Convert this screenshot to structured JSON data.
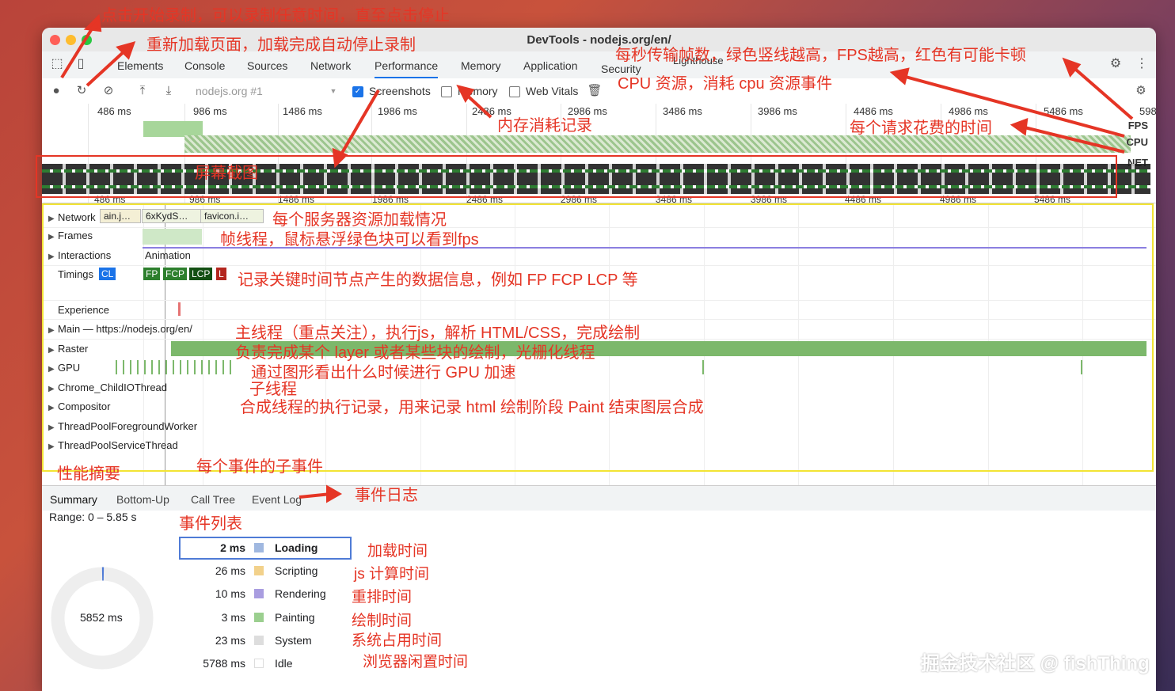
{
  "window": {
    "title": "DevTools - nodejs.org/en/"
  },
  "tabs": [
    "Elements",
    "Console",
    "Sources",
    "Network",
    "Performance",
    "Memory",
    "Application",
    "Security",
    "Lighthouse"
  ],
  "toolbar": {
    "target": "nodejs.org #1",
    "screenshots_label": "Screenshots",
    "memory_label": "Memory",
    "webvitals_label": "Web Vitals"
  },
  "overview": {
    "ticks": [
      "486 ms",
      "986 ms",
      "1486 ms",
      "1986 ms",
      "2486 ms",
      "2986 ms",
      "3486 ms",
      "3986 ms",
      "4486 ms",
      "4986 ms",
      "5486 ms",
      "598"
    ],
    "fps_label": "FPS",
    "cpu_label": "CPU",
    "net_label": "NET"
  },
  "tracks": {
    "network_label": "Network",
    "network_items": [
      "ain.j…",
      "6xKydS…",
      "favicon.i…"
    ],
    "frames": "Frames",
    "interactions": "Interactions",
    "animation": "Animation",
    "timings": "Timings",
    "timings_cl": "CL",
    "timing_badges": [
      "FP",
      "FCP",
      "LCP",
      "L"
    ],
    "experience": "Experience",
    "main": "Main — https://nodejs.org/en/",
    "raster": "Raster",
    "gpu": "GPU",
    "childio": "Chrome_ChildIOThread",
    "compositor": "Compositor",
    "tpfw": "ThreadPoolForegroundWorker",
    "tpst": "ThreadPoolServiceThread"
  },
  "bottom_tabs": [
    "Summary",
    "Bottom-Up",
    "Call Tree",
    "Event Log"
  ],
  "summary": {
    "range": "Range: 0 – 5.85 s",
    "total": "5852 ms",
    "rows": [
      {
        "ms": "2 ms",
        "name": "Loading",
        "color": "#a0b8e0"
      },
      {
        "ms": "26 ms",
        "name": "Scripting",
        "color": "#f2d18b"
      },
      {
        "ms": "10 ms",
        "name": "Rendering",
        "color": "#a99de0"
      },
      {
        "ms": "3 ms",
        "name": "Painting",
        "color": "#9bcf8f"
      },
      {
        "ms": "23 ms",
        "name": "System",
        "color": "#dddddd"
      },
      {
        "ms": "5788 ms",
        "name": "Idle",
        "color": "#ffffff"
      }
    ]
  },
  "annotations": {
    "a1": "点击开始录制，可以录制任意时间，直至点击停止",
    "a2": "重新加载页面，加载完成自动停止录制",
    "a3": "每秒传输帧数，绿色竖线越高，FPS越高，红色有可能卡顿",
    "a4": "CPU 资源，消耗 cpu 资源事件",
    "a5": "内存消耗记录",
    "a6": "每个请求花费的时间",
    "a7": "屏幕截图",
    "a8": "每个服务器资源加载情况",
    "a9": "帧线程，鼠标悬浮绿色块可以看到fps",
    "a10": "记录关键时间节点产生的数据信息，例如 FP FCP LCP 等",
    "a11": "主线程（重点关注），执行js，解析 HTML/CSS，完成绘制",
    "a12": "负责完成某个 layer 或者某些块的绘制，光栅化线程",
    "a13": "通过图形看出什么时候进行 GPU 加速",
    "a14": "子线程",
    "a15": "合成线程的执行记录，用来记录 html 绘制阶段 Paint 结束图层合成",
    "a16": "性能摘要",
    "a17": "每个事件的子事件",
    "a18": "事件日志",
    "a19": "事件列表",
    "sum1": "加载时间",
    "sum2": "js 计算时间",
    "sum3": "重排时间",
    "sum4": "绘制时间",
    "sum5": "系统占用时间",
    "sum6": "浏览器闲置时间"
  },
  "watermark": "掘金技术社区 @ fishThing"
}
